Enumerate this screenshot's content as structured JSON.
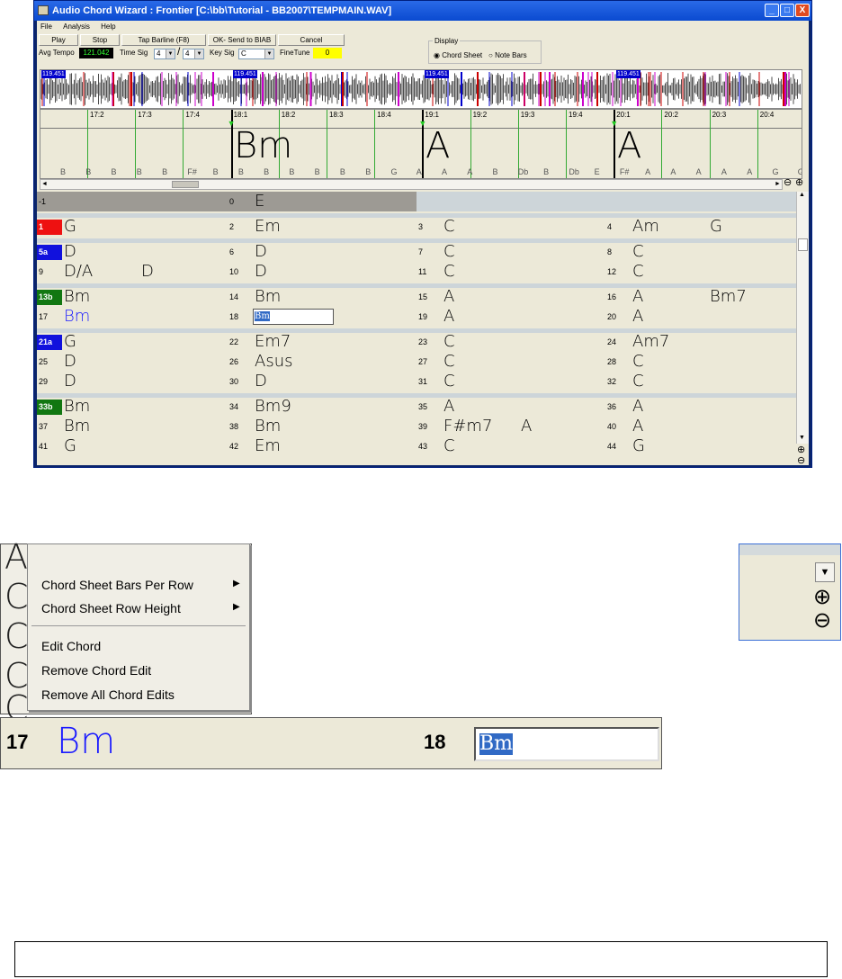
{
  "window": {
    "title": "Audio Chord Wizard : Frontier [C:\\bb\\Tutorial - BB2007\\TEMPMAIN.WAV]",
    "controls": [
      "_",
      "□",
      "X"
    ]
  },
  "menu": [
    "File",
    "Analysis",
    "Help"
  ],
  "toolbar": {
    "play": "Play",
    "stop": "Stop",
    "tap_barline": "Tap Barline (F8)",
    "ok_send": "OK- Send to BIAB",
    "cancel": "Cancel",
    "avg_tempo_label": "Avg Tempo",
    "avg_tempo_value": "121.042",
    "time_sig_label": "Time Sig",
    "time_sig_num": "4",
    "time_sig_den": "4",
    "key_sig_label": "Key Sig",
    "key_sig_value": "C",
    "finetune_label": "FineTune",
    "finetune_value": "0",
    "display_label": "Display",
    "display_opt1": "Chord Sheet",
    "display_opt2": "Note Bars"
  },
  "waveform": {
    "tempo_tags": [
      "119.451",
      "119.451",
      "119.451",
      "119.451"
    ]
  },
  "timeline": {
    "beats": [
      "17:2",
      "17:3",
      "17:4",
      "18:1",
      "18:2",
      "18:3",
      "18:4",
      "19:1",
      "19:2",
      "19:3",
      "19:4",
      "20:1",
      "20:2",
      "20:3",
      "20:4"
    ],
    "big_chords": [
      "Bm",
      "A",
      "A"
    ],
    "notes": [
      "B",
      "B",
      "B",
      "B",
      "B",
      "F#",
      "B",
      "B",
      "B",
      "B",
      "B",
      "B",
      "B",
      "G",
      "A",
      "A",
      "A",
      "B",
      "Db",
      "B",
      "Db",
      "E",
      "F#",
      "A",
      "A",
      "A",
      "A",
      "A",
      "G",
      "G"
    ]
  },
  "grid": {
    "header": {
      "num_left": "-1",
      "num_right": "0",
      "chord": "E"
    },
    "rows": [
      {
        "cells": [
          {
            "n": "1",
            "c": "G",
            "badge": "red"
          },
          {
            "n": "2",
            "c": "Em"
          },
          {
            "n": "3",
            "c": "C"
          },
          {
            "n": "4",
            "c": "Am",
            "c2": "G"
          }
        ]
      },
      {
        "cells": [
          {
            "n": "5a",
            "c": "D",
            "badge": "blue"
          },
          {
            "n": "6",
            "c": "D"
          },
          {
            "n": "7",
            "c": "C"
          },
          {
            "n": "8",
            "c": "C"
          }
        ]
      },
      {
        "cells": [
          {
            "n": "9",
            "c": "D/A",
            "c2": "D"
          },
          {
            "n": "10",
            "c": "D"
          },
          {
            "n": "11",
            "c": "C"
          },
          {
            "n": "12",
            "c": "C"
          }
        ]
      },
      {
        "cells": [
          {
            "n": "13b",
            "c": "Bm",
            "badge": "green"
          },
          {
            "n": "14",
            "c": "Bm"
          },
          {
            "n": "15",
            "c": "A"
          },
          {
            "n": "16",
            "c": "A",
            "c2": "Bm7"
          }
        ]
      },
      {
        "cells": [
          {
            "n": "17",
            "c": "Bm",
            "blue": true
          },
          {
            "n": "18",
            "c": "Bm",
            "edit": true
          },
          {
            "n": "19",
            "c": "A"
          },
          {
            "n": "20",
            "c": "A"
          }
        ]
      },
      {
        "cells": [
          {
            "n": "21a",
            "c": "G",
            "badge": "blue"
          },
          {
            "n": "22",
            "c": "Em7"
          },
          {
            "n": "23",
            "c": "C"
          },
          {
            "n": "24",
            "c": "Am7"
          }
        ]
      },
      {
        "cells": [
          {
            "n": "25",
            "c": "D"
          },
          {
            "n": "26",
            "c": "Asus"
          },
          {
            "n": "27",
            "c": "C"
          },
          {
            "n": "28",
            "c": "C"
          }
        ]
      },
      {
        "cells": [
          {
            "n": "29",
            "c": "D"
          },
          {
            "n": "30",
            "c": "D"
          },
          {
            "n": "31",
            "c": "C"
          },
          {
            "n": "32",
            "c": "C"
          }
        ]
      },
      {
        "cells": [
          {
            "n": "33b",
            "c": "Bm",
            "badge": "green"
          },
          {
            "n": "34",
            "c": "Bm9"
          },
          {
            "n": "35",
            "c": "A"
          },
          {
            "n": "36",
            "c": "A"
          }
        ]
      },
      {
        "cells": [
          {
            "n": "37",
            "c": "Bm"
          },
          {
            "n": "38",
            "c": "Bm"
          },
          {
            "n": "39",
            "c": "F#m7",
            "c2": "A"
          },
          {
            "n": "40",
            "c": "A"
          }
        ]
      },
      {
        "cells": [
          {
            "n": "41",
            "c": "G"
          },
          {
            "n": "42",
            "c": "Em"
          },
          {
            "n": "43",
            "c": "C"
          },
          {
            "n": "44",
            "c": "G"
          }
        ]
      }
    ]
  },
  "context_menu": {
    "items": [
      "Chord Sheet Bars Per Row",
      "Chord Sheet Row Height",
      "Edit Chord",
      "Remove Chord Edit",
      "Remove All Chord Edits"
    ],
    "bg_letters": [
      "A",
      "C",
      "C",
      "C",
      "C"
    ]
  },
  "zoom_detail": {
    "plus": "⊕",
    "minus": "⊖",
    "arrow": "▼"
  },
  "row_detail": {
    "n1": "17",
    "c1": "Bm",
    "n2": "18",
    "c2": "Bm"
  },
  "colors": {
    "red": "#ee1111",
    "blue": "#1111dd",
    "green": "#117711",
    "chord_blue": "#1a1aff"
  }
}
